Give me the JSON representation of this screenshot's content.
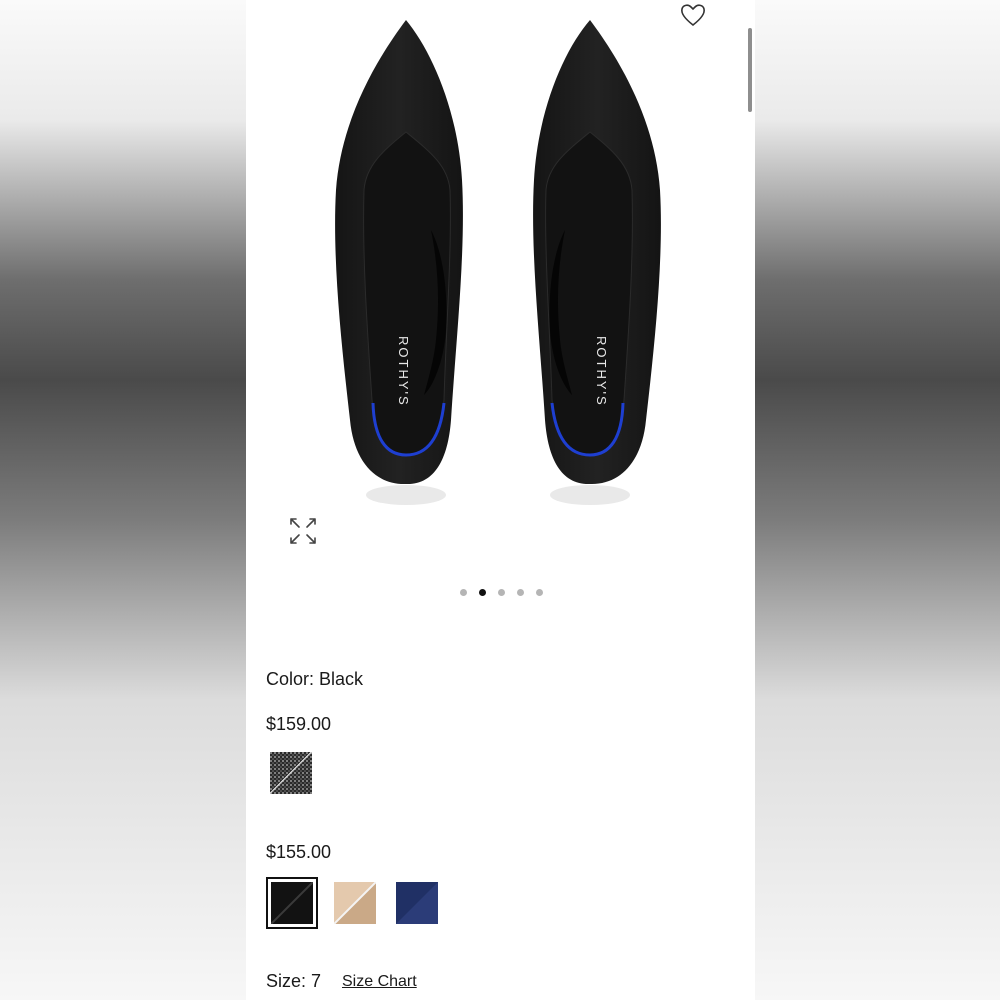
{
  "product": {
    "color_label": "Color:",
    "color_value": "Black",
    "size_label": "Size:",
    "size_value": "7",
    "size_chart_link": "Size Chart"
  },
  "price_groups": [
    {
      "price": "$159.00",
      "swatches": [
        {
          "name": "black-pattern",
          "colors": [
            "#2a2a2a",
            "#d9d9d9"
          ]
        }
      ]
    },
    {
      "price": "$155.00",
      "swatches": [
        {
          "name": "black",
          "colors": [
            "#111111",
            "#2a2a2a"
          ],
          "selected": true
        },
        {
          "name": "beige",
          "colors": [
            "#e6cdb2",
            "#c9a988"
          ]
        },
        {
          "name": "navy",
          "colors": [
            "#1f2f63",
            "#2d3f7a"
          ]
        }
      ]
    }
  ],
  "gallery": {
    "image_count": 5,
    "active_index": 1,
    "brand_print": "ROTHY'S"
  },
  "icons": {
    "favorite": "heart-icon",
    "expand": "expand-icon"
  },
  "colors": {
    "shoe": "#1b1b1b",
    "heel_accent": "#1e3fd1",
    "text": "#1a1a1a"
  }
}
